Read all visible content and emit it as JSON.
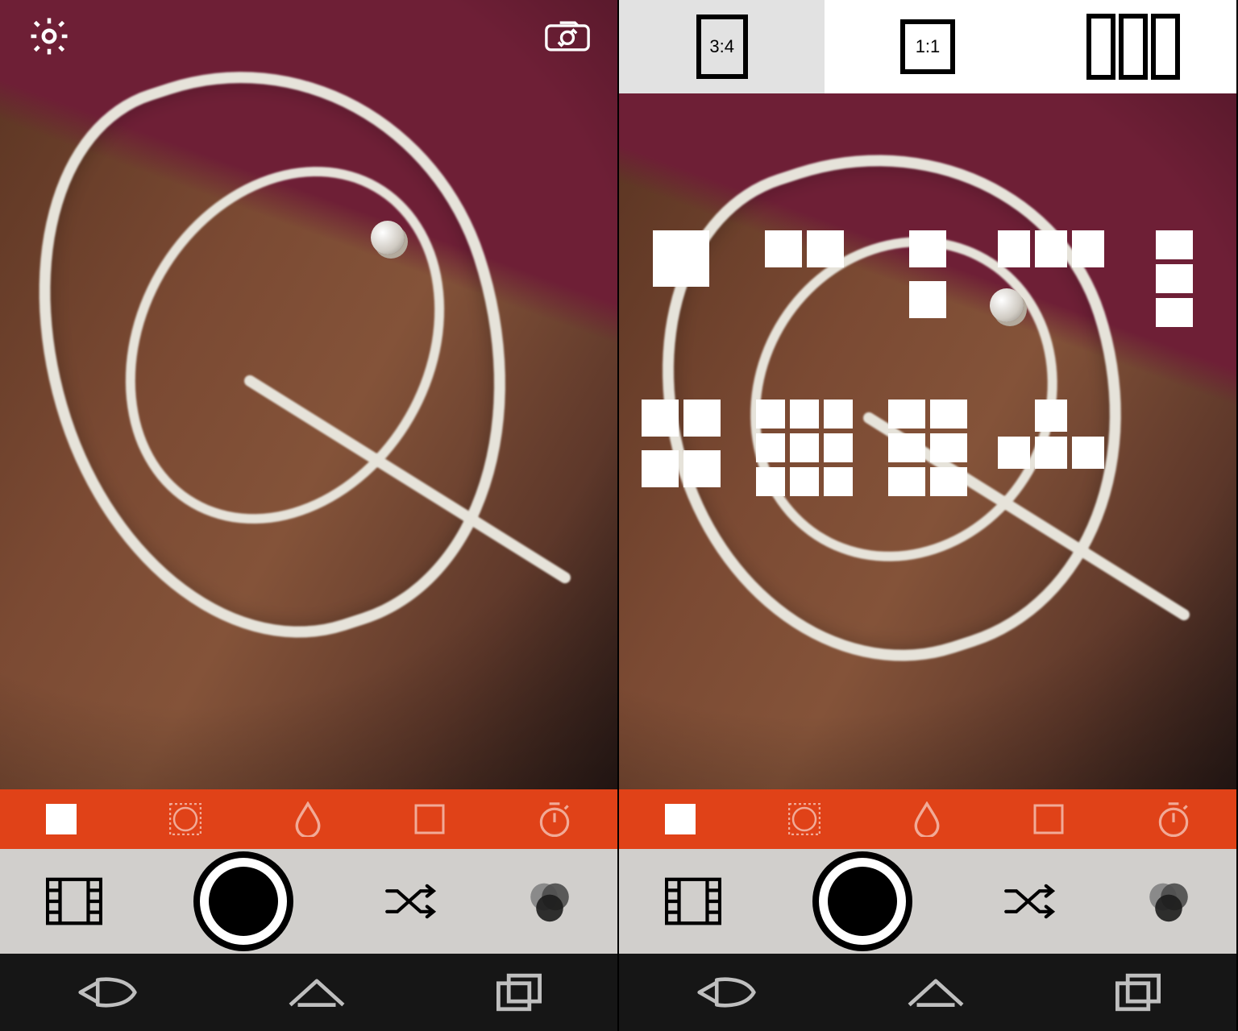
{
  "colors": {
    "accent": "#e04218"
  },
  "aspect": {
    "items": [
      {
        "label": "3:4",
        "selected": true
      },
      {
        "label": "1:1",
        "selected": false
      },
      {
        "label": "strips",
        "selected": false
      }
    ]
  },
  "layouts": [
    {
      "name": "single",
      "cols": 1,
      "rows": 1
    },
    {
      "name": "two-horiz",
      "cols": 2,
      "rows": 1
    },
    {
      "name": "two-vert",
      "cols": 1,
      "rows": 2
    },
    {
      "name": "three-horiz",
      "cols": 3,
      "rows": 1
    },
    {
      "name": "three-vert",
      "cols": 1,
      "rows": 3
    },
    {
      "name": "four-grid",
      "cols": 2,
      "rows": 2
    },
    {
      "name": "nine-grid",
      "cols": 3,
      "rows": 3
    },
    {
      "name": "six-vert",
      "cols": 2,
      "rows": 3
    },
    {
      "name": "t-shape",
      "custom": true
    }
  ],
  "tools": [
    {
      "name": "layout",
      "active": true
    },
    {
      "name": "vignette",
      "active": false
    },
    {
      "name": "blur",
      "active": false
    },
    {
      "name": "frame",
      "active": false
    },
    {
      "name": "timer",
      "active": false
    }
  ],
  "controls": {
    "gallery": "gallery",
    "shutter": "shutter",
    "shuffle": "shuffle",
    "filters": "filters"
  },
  "nav": [
    "back",
    "home",
    "recent"
  ]
}
